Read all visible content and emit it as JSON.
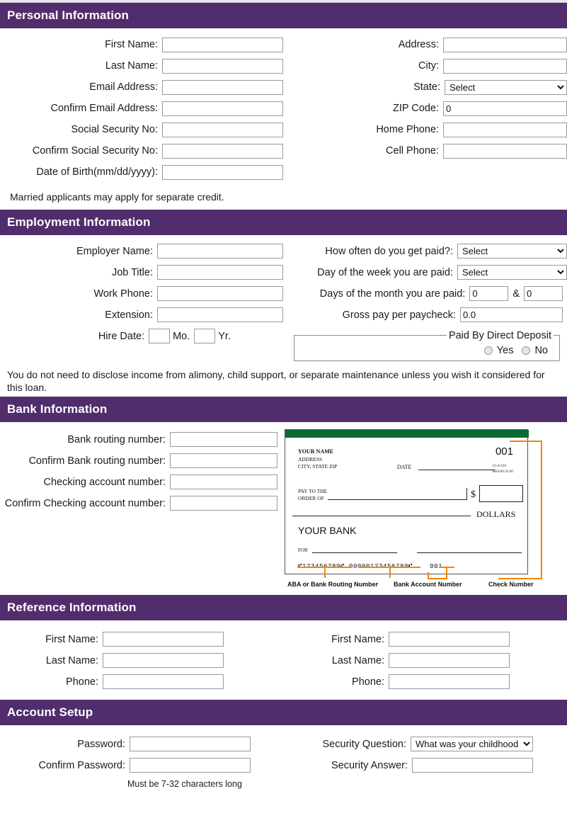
{
  "theme": {
    "header_bg": "#512d6d",
    "header_text": "#ffffff",
    "check_band": "#0b6b33",
    "annotation": "#f0860a"
  },
  "sections": {
    "personal": {
      "title": "Personal Information",
      "left_fields": [
        {
          "label": "First Name:",
          "value": "",
          "type": "text"
        },
        {
          "label": "Last Name:",
          "value": "",
          "type": "text"
        },
        {
          "label": "Email Address:",
          "value": "",
          "type": "text"
        },
        {
          "label": "Confirm Email Address:",
          "value": "",
          "type": "text"
        },
        {
          "label": "Social Security No:",
          "value": "",
          "type": "text"
        },
        {
          "label": "Confirm Social Security No:",
          "value": "",
          "type": "text"
        },
        {
          "label": "Date of Birth(mm/dd/yyyy):",
          "value": "",
          "type": "text"
        }
      ],
      "right_fields": [
        {
          "label": "Address:",
          "value": "",
          "type": "text"
        },
        {
          "label": "City:",
          "value": "",
          "type": "text"
        },
        {
          "label": "State:",
          "value": "Select",
          "type": "select"
        },
        {
          "label": "ZIP Code:",
          "value": "0",
          "type": "text"
        },
        {
          "label": "Home Phone:",
          "value": "",
          "type": "text"
        },
        {
          "label": "Cell Phone:",
          "value": "",
          "type": "text"
        }
      ],
      "note": "Married applicants may apply for separate credit."
    },
    "employment": {
      "title": "Employment Information",
      "left_fields": [
        {
          "label": "Employer Name:",
          "value": "",
          "type": "text"
        },
        {
          "label": "Job Title:",
          "value": "",
          "type": "text"
        },
        {
          "label": "Work Phone:",
          "value": "",
          "type": "text"
        },
        {
          "label": "Extension:",
          "value": "",
          "type": "text"
        }
      ],
      "hire_date": {
        "label": "Hire Date:",
        "month_value": "",
        "month_unit": "Mo.",
        "year_value": "",
        "year_unit": "Yr."
      },
      "pay_frequency": {
        "label": "How often do you get paid?:",
        "value": "Select"
      },
      "pay_day_week": {
        "label": "Day of the week you are paid:",
        "value": "Select"
      },
      "pay_days_month": {
        "label": "Days of the month you are paid:",
        "value_1": "0",
        "separator": "&",
        "value_2": "0"
      },
      "gross_pay": {
        "label": "Gross pay per paycheck:",
        "value": "0.0"
      },
      "direct_deposit": {
        "legend": "Paid By Direct Deposit",
        "options": [
          "Yes",
          "No"
        ]
      },
      "note": "You do not need to disclose income from alimony, child support, or separate maintenance unless you wish it considered for this loan."
    },
    "bank": {
      "title": "Bank Information",
      "left_fields": [
        {
          "label": "Bank routing number:",
          "value": "",
          "type": "text"
        },
        {
          "label": "Confirm Bank routing number:",
          "value": "",
          "type": "text"
        },
        {
          "label": "Checking account number:",
          "value": "",
          "type": "text"
        },
        {
          "label": "Confirm Checking account number:",
          "value": "",
          "type": "text"
        }
      ],
      "check_image": {
        "payer_name": "YOUR NAME",
        "payer_address": "ADDRESS",
        "payer_city": "CITY, STATE ZIP",
        "date_label": "DATE",
        "check_number": "001",
        "fraction_top": "10-4/320",
        "fraction_bottom": "BRANCH 00",
        "pay_to_line1": "PAY TO THE",
        "pay_to_line2": "ORDER OF",
        "dollar_sign": "$",
        "dollars_word": "DOLLARS",
        "bank_name": "YOUR BANK",
        "for_label": "FOR",
        "micr_routing": "⑈123456789⑈",
        "micr_account": "00000123456789⑆",
        "micr_check": "001",
        "annotation_routing": "ABA or Bank Routing Number",
        "annotation_account": "Bank Account Number",
        "annotation_check": "Check Number"
      }
    },
    "reference": {
      "title": "Reference Information",
      "left_fields": [
        {
          "label": "First Name:",
          "value": "",
          "type": "text"
        },
        {
          "label": "Last Name:",
          "value": "",
          "type": "text"
        },
        {
          "label": "Phone:",
          "value": "",
          "type": "text"
        }
      ],
      "right_fields": [
        {
          "label": "First Name:",
          "value": "",
          "type": "text"
        },
        {
          "label": "Last Name:",
          "value": "",
          "type": "text"
        },
        {
          "label": "Phone:",
          "value": "",
          "type": "text"
        }
      ]
    },
    "account": {
      "title": "Account Setup",
      "left_fields": [
        {
          "label": "Password:",
          "value": "",
          "type": "text"
        },
        {
          "label": "Confirm Password:",
          "value": "",
          "type": "text"
        }
      ],
      "password_hint": "Must be 7-32 characters long",
      "security_question": {
        "label": "Security Question:",
        "value": "What was your childhood"
      },
      "security_answer": {
        "label": "Security Answer:",
        "value": ""
      }
    }
  }
}
